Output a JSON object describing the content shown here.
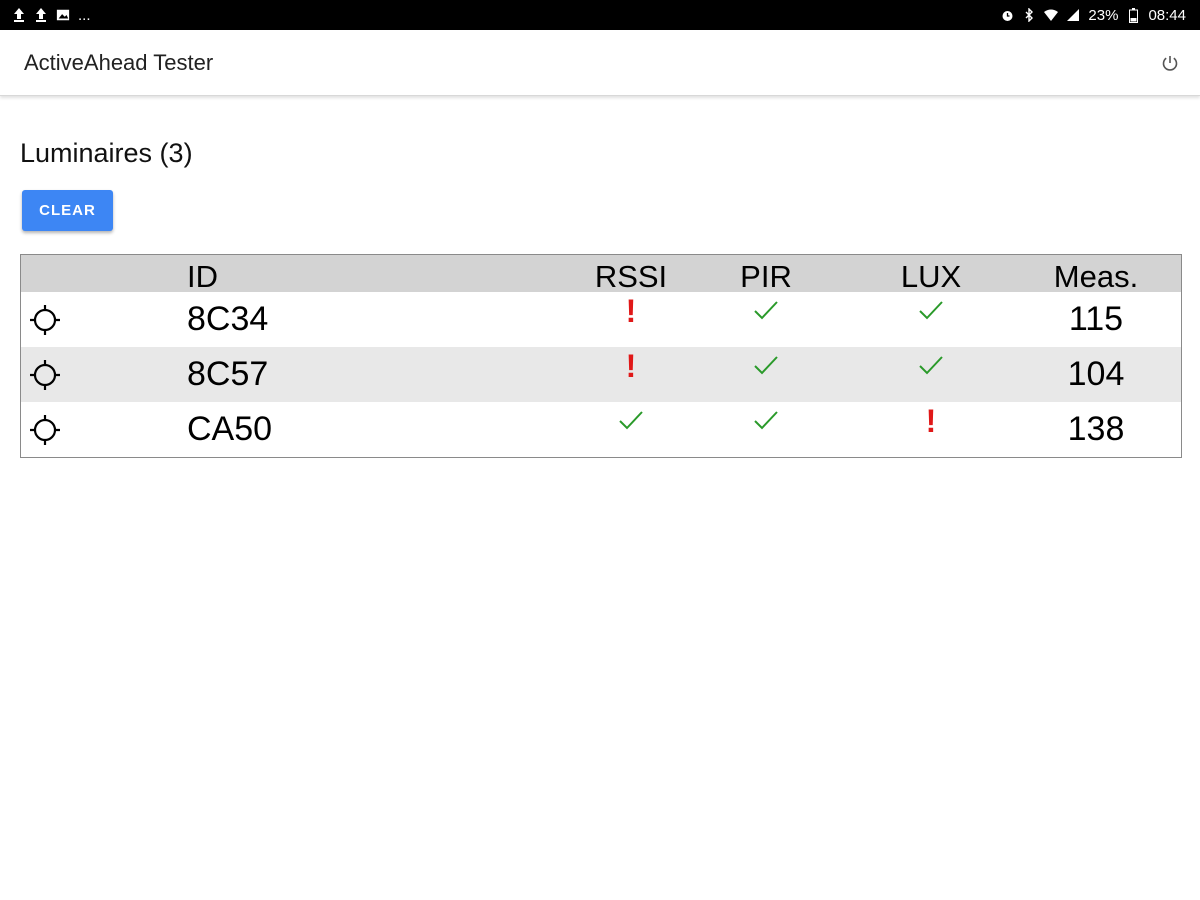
{
  "status_bar": {
    "overflow": "...",
    "battery": "23%",
    "time": "08:44"
  },
  "app": {
    "title": "ActiveAhead Tester"
  },
  "section": {
    "title": "Luminaires (3)",
    "clear_label": "CLEAR"
  },
  "table": {
    "headers": {
      "id": "ID",
      "rssi": "RSSI",
      "pir": "PIR",
      "lux": "LUX",
      "meas": "Meas."
    },
    "rows": [
      {
        "id": "8C34",
        "rssi": "warn",
        "pir": "ok",
        "lux": "ok",
        "meas": "115"
      },
      {
        "id": "8C57",
        "rssi": "warn",
        "pir": "ok",
        "lux": "ok",
        "meas": "104"
      },
      {
        "id": "CA50",
        "rssi": "ok",
        "pir": "ok",
        "lux": "warn",
        "meas": "138"
      }
    ],
    "marks": {
      "warn": "!"
    },
    "colors": {
      "ok": "#2a9a2a",
      "warn": "#e01818",
      "button": "#3d86f4",
      "header": "#d3d3d3",
      "alt_row": "#e8e8e8"
    }
  }
}
